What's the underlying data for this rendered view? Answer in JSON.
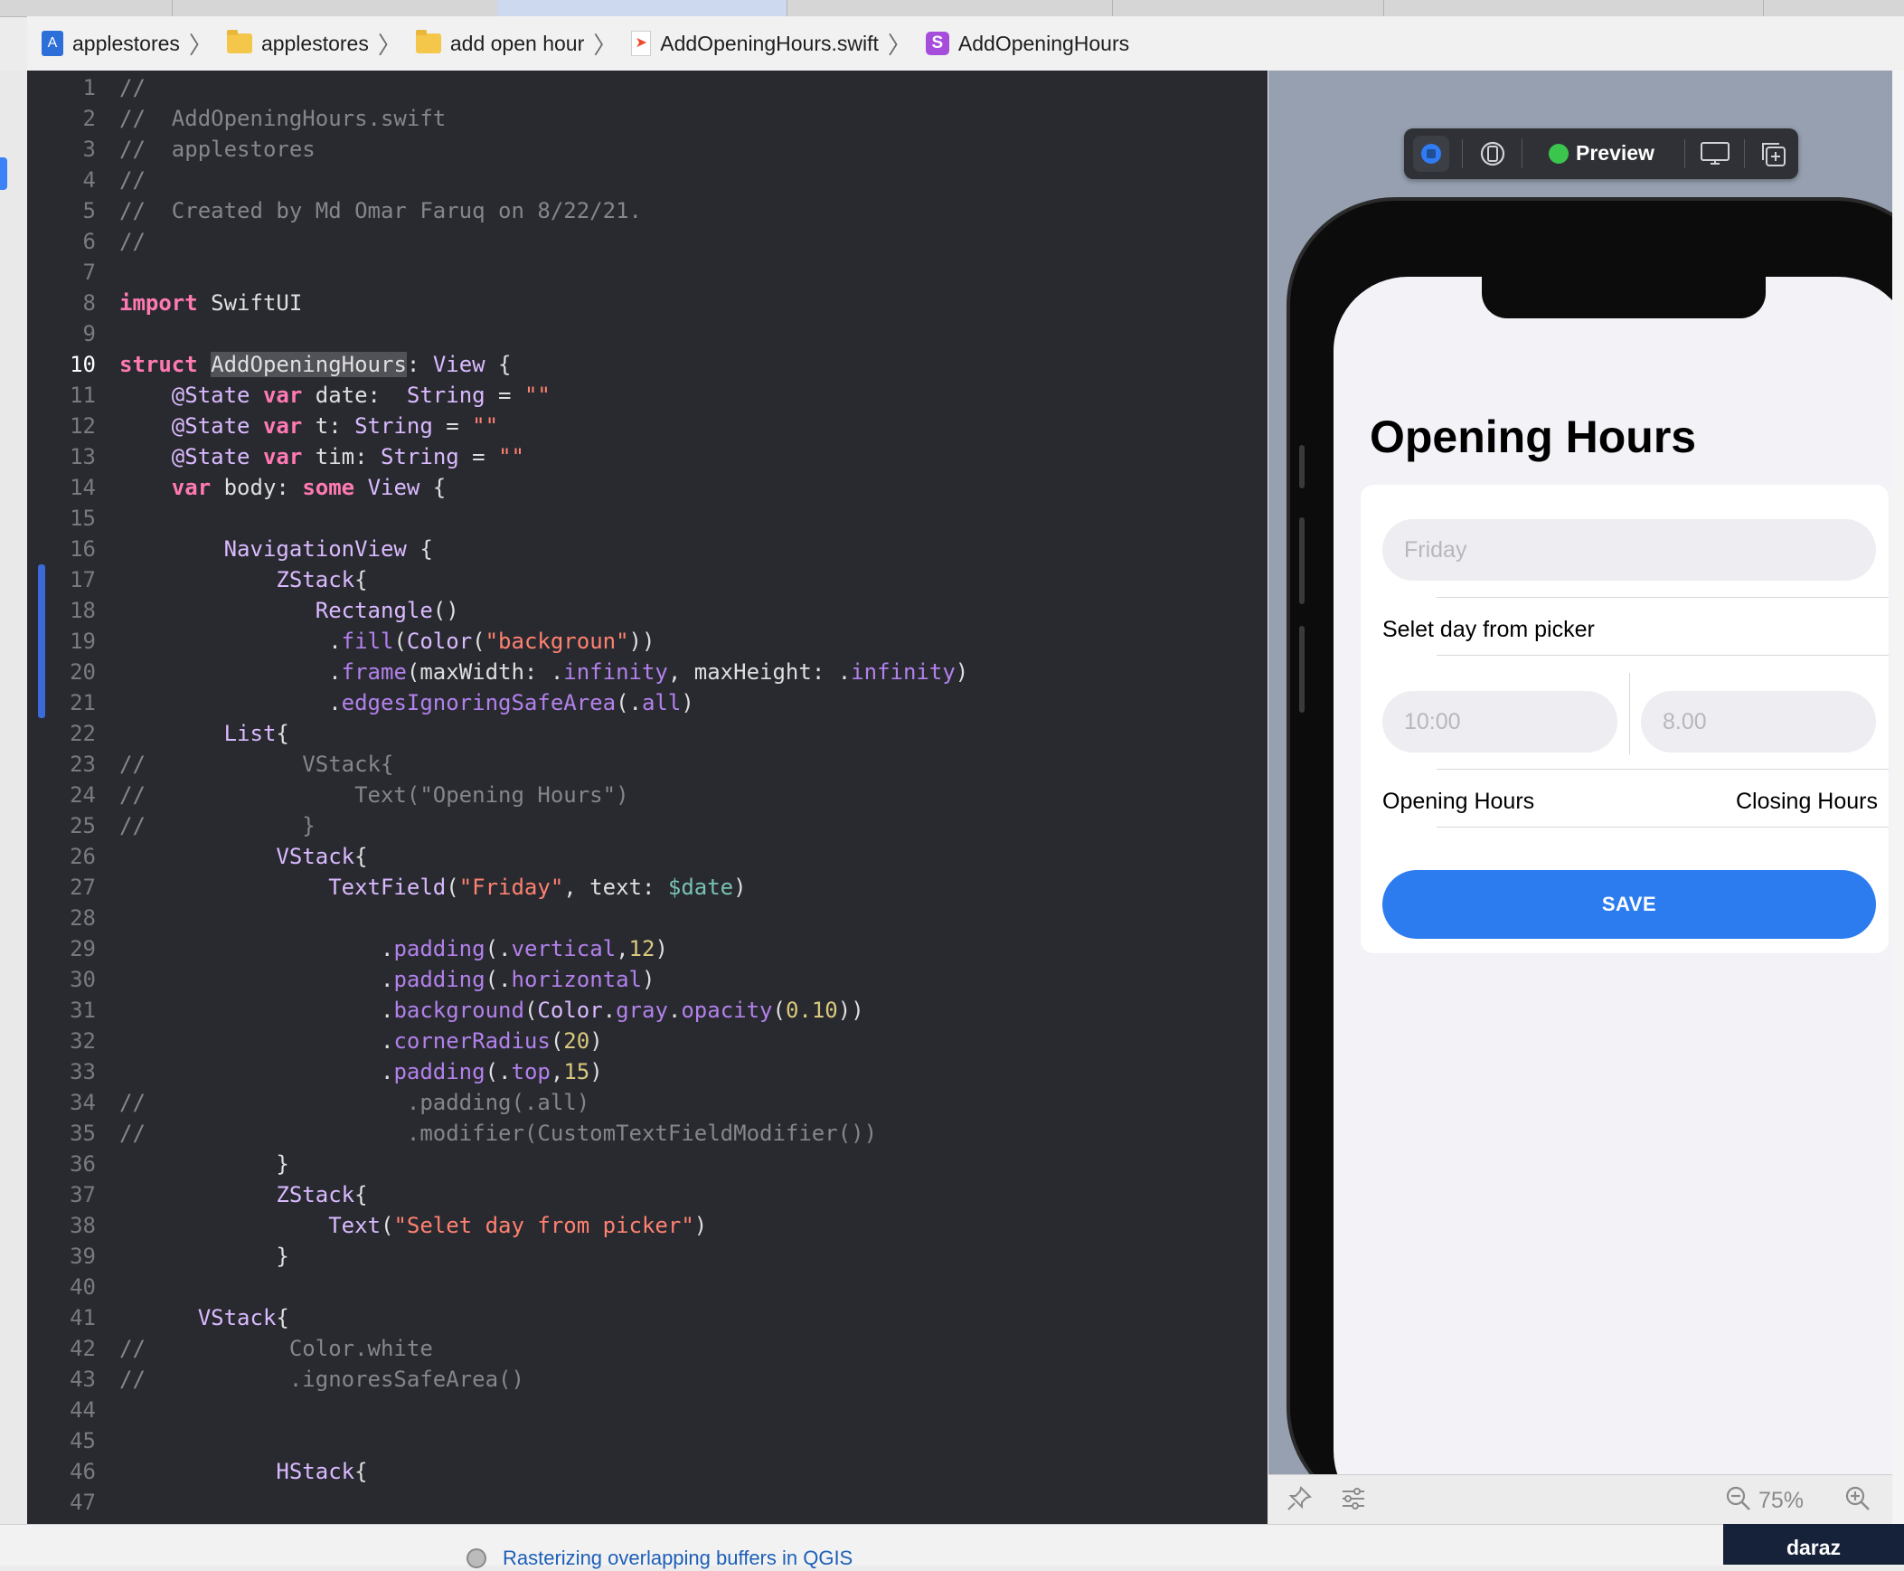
{
  "breadcrumb": {
    "items": [
      {
        "label": "applestores",
        "icon": "app-project-icon"
      },
      {
        "label": "applestores",
        "icon": "folder-icon"
      },
      {
        "label": "add open hour",
        "icon": "folder-icon"
      },
      {
        "label": "AddOpeningHours.swift",
        "icon": "swift-file-icon"
      },
      {
        "label": "AddOpeningHours",
        "icon": "struct-icon"
      }
    ],
    "struct_icon_letter": "S"
  },
  "editor": {
    "current_line": 10,
    "lines": [
      {
        "n": "1",
        "code": [
          [
            "c",
            "//"
          ]
        ]
      },
      {
        "n": "2",
        "code": [
          [
            "c",
            "//  AddOpeningHours.swift"
          ]
        ]
      },
      {
        "n": "3",
        "code": [
          [
            "c",
            "//  applestores"
          ]
        ]
      },
      {
        "n": "4",
        "code": [
          [
            "c",
            "//"
          ]
        ]
      },
      {
        "n": "5",
        "code": [
          [
            "c",
            "//  Created by Md Omar Faruq on 8/22/21."
          ]
        ]
      },
      {
        "n": "6",
        "code": [
          [
            "c",
            "//"
          ]
        ]
      },
      {
        "n": "7",
        "code": []
      },
      {
        "n": "8",
        "code": [
          [
            "k",
            "import"
          ],
          [
            "p",
            " SwiftUI"
          ]
        ]
      },
      {
        "n": "9",
        "code": []
      },
      {
        "n": "10",
        "code": [
          [
            "k",
            "struct"
          ],
          [
            "p",
            " "
          ],
          [
            "h",
            "AddOpeningHours"
          ],
          [
            "p",
            ": "
          ],
          [
            "t",
            "View"
          ],
          [
            "p",
            " {"
          ]
        ]
      },
      {
        "n": "11",
        "code": [
          [
            "p",
            "    "
          ],
          [
            "t",
            "@State"
          ],
          [
            "p",
            " "
          ],
          [
            "k",
            "var"
          ],
          [
            "p",
            " date:  "
          ],
          [
            "t",
            "String"
          ],
          [
            "p",
            " = "
          ],
          [
            "s",
            "\"\""
          ]
        ]
      },
      {
        "n": "12",
        "code": [
          [
            "p",
            "    "
          ],
          [
            "t",
            "@State"
          ],
          [
            "p",
            " "
          ],
          [
            "k",
            "var"
          ],
          [
            "p",
            " t: "
          ],
          [
            "t",
            "String"
          ],
          [
            "p",
            " = "
          ],
          [
            "s",
            "\"\""
          ]
        ]
      },
      {
        "n": "13",
        "code": [
          [
            "p",
            "    "
          ],
          [
            "t",
            "@State"
          ],
          [
            "p",
            " "
          ],
          [
            "k",
            "var"
          ],
          [
            "p",
            " tim: "
          ],
          [
            "t",
            "String"
          ],
          [
            "p",
            " = "
          ],
          [
            "s",
            "\"\""
          ]
        ]
      },
      {
        "n": "14",
        "code": [
          [
            "p",
            "    "
          ],
          [
            "k",
            "var"
          ],
          [
            "p",
            " body: "
          ],
          [
            "k",
            "some"
          ],
          [
            "p",
            " "
          ],
          [
            "t",
            "View"
          ],
          [
            "p",
            " {"
          ]
        ]
      },
      {
        "n": "15",
        "code": []
      },
      {
        "n": "16",
        "code": [
          [
            "p",
            "        "
          ],
          [
            "t",
            "NavigationView"
          ],
          [
            "p",
            " {"
          ]
        ]
      },
      {
        "n": "17",
        "code": [
          [
            "p",
            "            "
          ],
          [
            "t",
            "ZStack"
          ],
          [
            "p",
            "{"
          ]
        ]
      },
      {
        "n": "18",
        "code": [
          [
            "p",
            "               "
          ],
          [
            "t",
            "Rectangle"
          ],
          [
            "p",
            "()"
          ]
        ]
      },
      {
        "n": "19",
        "code": [
          [
            "p",
            "                ."
          ],
          [
            "f",
            "fill"
          ],
          [
            "p",
            "("
          ],
          [
            "t",
            "Color"
          ],
          [
            "p",
            "("
          ],
          [
            "s",
            "\"backgroun\""
          ],
          [
            "p",
            "))"
          ]
        ]
      },
      {
        "n": "20",
        "code": [
          [
            "p",
            "                ."
          ],
          [
            "f",
            "frame"
          ],
          [
            "p",
            "(maxWidth: ."
          ],
          [
            "f",
            "infinity"
          ],
          [
            "p",
            ", maxHeight: ."
          ],
          [
            "f",
            "infinity"
          ],
          [
            "p",
            ")"
          ]
        ]
      },
      {
        "n": "21",
        "code": [
          [
            "p",
            "                ."
          ],
          [
            "f",
            "edgesIgnoringSafeArea"
          ],
          [
            "p",
            "(."
          ],
          [
            "f",
            "all"
          ],
          [
            "p",
            ")"
          ]
        ]
      },
      {
        "n": "22",
        "code": [
          [
            "p",
            "        "
          ],
          [
            "t",
            "List"
          ],
          [
            "p",
            "{"
          ]
        ]
      },
      {
        "n": "23",
        "code": [
          [
            "c",
            "//            VStack{"
          ]
        ]
      },
      {
        "n": "24",
        "code": [
          [
            "c",
            "//                Text(\"Opening Hours\")"
          ]
        ]
      },
      {
        "n": "25",
        "code": [
          [
            "c",
            "//            }"
          ]
        ]
      },
      {
        "n": "26",
        "code": [
          [
            "p",
            "            "
          ],
          [
            "t",
            "VStack"
          ],
          [
            "p",
            "{"
          ]
        ]
      },
      {
        "n": "27",
        "code": [
          [
            "p",
            "                "
          ],
          [
            "t",
            "TextField"
          ],
          [
            "p",
            "("
          ],
          [
            "s",
            "\"Friday\""
          ],
          [
            "p",
            ", text: "
          ],
          [
            "v",
            "$date"
          ],
          [
            "p",
            ")"
          ]
        ]
      },
      {
        "n": "28",
        "code": []
      },
      {
        "n": "29",
        "code": [
          [
            "p",
            "                    ."
          ],
          [
            "f",
            "padding"
          ],
          [
            "p",
            "(."
          ],
          [
            "f",
            "vertical"
          ],
          [
            "p",
            ","
          ],
          [
            "n",
            "12"
          ],
          [
            "p",
            ")"
          ]
        ]
      },
      {
        "n": "30",
        "code": [
          [
            "p",
            "                    ."
          ],
          [
            "f",
            "padding"
          ],
          [
            "p",
            "(."
          ],
          [
            "f",
            "horizontal"
          ],
          [
            "p",
            ")"
          ]
        ]
      },
      {
        "n": "31",
        "code": [
          [
            "p",
            "                    ."
          ],
          [
            "f",
            "background"
          ],
          [
            "p",
            "("
          ],
          [
            "t",
            "Color"
          ],
          [
            "p",
            "."
          ],
          [
            "f",
            "gray"
          ],
          [
            "p",
            "."
          ],
          [
            "f",
            "opacity"
          ],
          [
            "p",
            "("
          ],
          [
            "n",
            "0.10"
          ],
          [
            "p",
            "))"
          ]
        ]
      },
      {
        "n": "32",
        "code": [
          [
            "p",
            "                    ."
          ],
          [
            "f",
            "cornerRadius"
          ],
          [
            "p",
            "("
          ],
          [
            "n",
            "20"
          ],
          [
            "p",
            ")"
          ]
        ]
      },
      {
        "n": "33",
        "code": [
          [
            "p",
            "                    ."
          ],
          [
            "f",
            "padding"
          ],
          [
            "p",
            "(."
          ],
          [
            "f",
            "top"
          ],
          [
            "p",
            ","
          ],
          [
            "n",
            "15"
          ],
          [
            "p",
            ")"
          ]
        ]
      },
      {
        "n": "34",
        "code": [
          [
            "c",
            "//                    .padding(.all)"
          ]
        ]
      },
      {
        "n": "35",
        "code": [
          [
            "c",
            "//                    .modifier(CustomTextFieldModifier())"
          ]
        ]
      },
      {
        "n": "36",
        "code": [
          [
            "p",
            "            }"
          ]
        ]
      },
      {
        "n": "37",
        "code": [
          [
            "p",
            "            "
          ],
          [
            "t",
            "ZStack"
          ],
          [
            "p",
            "{"
          ]
        ]
      },
      {
        "n": "38",
        "code": [
          [
            "p",
            "                "
          ],
          [
            "t",
            "Text"
          ],
          [
            "p",
            "("
          ],
          [
            "s",
            "\"Selet day from picker\""
          ],
          [
            "p",
            ")"
          ]
        ]
      },
      {
        "n": "39",
        "code": [
          [
            "p",
            "            }"
          ]
        ]
      },
      {
        "n": "40",
        "code": []
      },
      {
        "n": "41",
        "code": [
          [
            "p",
            "      "
          ],
          [
            "t",
            "VStack"
          ],
          [
            "p",
            "{"
          ]
        ]
      },
      {
        "n": "42",
        "code": [
          [
            "c",
            "//           Color.white"
          ]
        ]
      },
      {
        "n": "43",
        "code": [
          [
            "c",
            "//           .ignoresSafeArea()"
          ]
        ]
      },
      {
        "n": "44",
        "code": []
      },
      {
        "n": "45",
        "code": []
      },
      {
        "n": "46",
        "code": [
          [
            "p",
            "            "
          ],
          [
            "t",
            "HStack"
          ],
          [
            "p",
            "{"
          ]
        ]
      },
      {
        "n": "47",
        "code": []
      }
    ]
  },
  "preview_bar": {
    "label": "Preview",
    "buttons": [
      "live-preview-icon",
      "device-variants-icon",
      "device-settings-icon",
      "duplicate-preview-icon"
    ]
  },
  "app_preview": {
    "title": "Opening Hours",
    "date_placeholder": "Friday",
    "picker_label": "Selet day from picker",
    "opening_placeholder": "10:00",
    "closing_placeholder": "8.00",
    "opening_label": "Opening Hours",
    "closing_label": "Closing Hours",
    "save_label": "SAVE"
  },
  "preview_footer": {
    "zoom": "75%"
  },
  "bottom": {
    "link": "Rasterizing overlapping buffers in QGIS",
    "ad_label": "daraz"
  },
  "colors": {
    "editor_bg": "#292a30",
    "keyword": "#ff7ab2",
    "type": "#dabaff",
    "string": "#ff8170",
    "number": "#d9c97c",
    "function": "#b281eb",
    "comment": "#84868c",
    "save_button": "#2c7cf0"
  }
}
